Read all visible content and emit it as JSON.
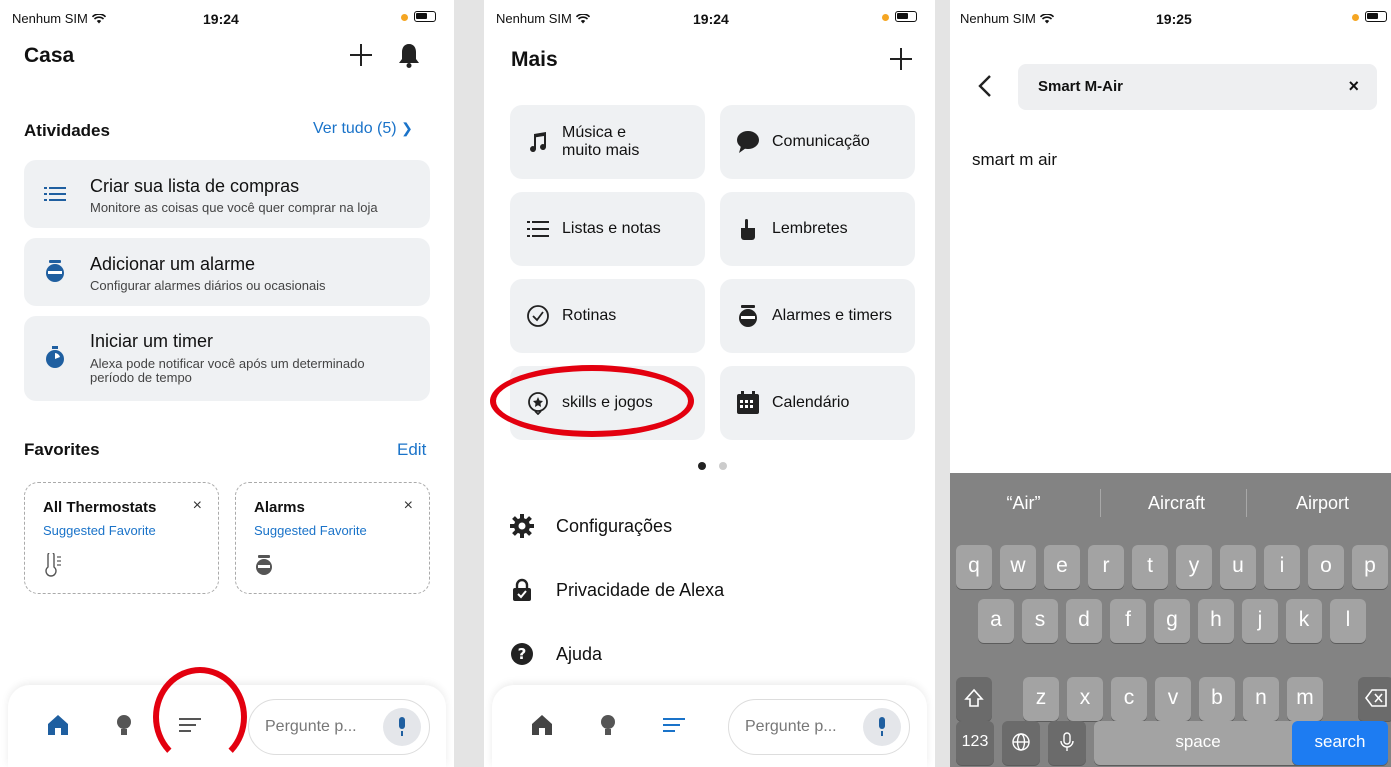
{
  "status_bar": {
    "carrier": "Nenhum SIM",
    "times": [
      "19:24",
      "19:24",
      "19:25"
    ]
  },
  "screen1": {
    "title": "Casa",
    "activities_title": "Atividades",
    "see_all": "Ver tudo (5)",
    "cards": [
      {
        "title": "Criar sua lista de compras",
        "subtitle": "Monitore as coisas que você quer comprar na loja",
        "icon": "list-icon"
      },
      {
        "title": "Adicionar um alarme",
        "subtitle": "Configurar alarmes diários ou ocasionais",
        "icon": "alarm-clock-icon"
      },
      {
        "title": "Iniciar um timer",
        "subtitle": "Alexa pode notificar você após um determinado período de tempo",
        "icon": "timer-icon"
      }
    ],
    "favorites_title": "Favorites",
    "edit": "Edit",
    "favorites": [
      {
        "title": "All Thermostats",
        "subtitle": "Suggested Favorite",
        "close": "×",
        "icon": "thermostat-icon"
      },
      {
        "title": "Alarms",
        "subtitle": "Suggested Favorite",
        "close": "×",
        "icon": "alarm-clock-icon"
      }
    ],
    "ask_placeholder": "Pergunte p..."
  },
  "screen2": {
    "title": "Mais",
    "tiles": [
      {
        "label": "Música e\nmuito mais",
        "icon": "music-note-icon"
      },
      {
        "label": "Comunicação",
        "icon": "chat-bubble-icon"
      },
      {
        "label": "Listas e notas",
        "icon": "list-icon"
      },
      {
        "label": "Lembretes",
        "icon": "reminder-hand-icon"
      },
      {
        "label": "Rotinas",
        "icon": "routine-check-icon"
      },
      {
        "label": "Alarmes e timers",
        "icon": "alarm-clock-icon"
      },
      {
        "label": "skills e jogos",
        "icon": "skills-badge-icon"
      },
      {
        "label": "Calendário",
        "icon": "calendar-icon"
      }
    ],
    "menu": [
      {
        "label": "Configurações",
        "icon": "gear-icon"
      },
      {
        "label": "Privacidade de Alexa",
        "icon": "lock-icon"
      },
      {
        "label": "Ajuda",
        "icon": "help-icon"
      }
    ],
    "ask_placeholder": "Pergunte p..."
  },
  "screen3": {
    "search_value": "Smart M-Air",
    "clear": "×",
    "result": "smart m air",
    "suggestions": [
      "“Air”",
      "Aircraft",
      "Airport"
    ],
    "keyboard": {
      "row1": [
        "q",
        "w",
        "e",
        "r",
        "t",
        "y",
        "u",
        "i",
        "o",
        "p"
      ],
      "row2": [
        "a",
        "s",
        "d",
        "f",
        "g",
        "h",
        "j",
        "k",
        "l"
      ],
      "row3": [
        "z",
        "x",
        "c",
        "v",
        "b",
        "n",
        "m"
      ],
      "numbers": "123",
      "space": "space",
      "search": "search"
    }
  },
  "colors": {
    "accent": "#1a73c9",
    "annotation": "#e3000f",
    "keyboard_bg": "#838383",
    "search_key": "#1d7cf2"
  }
}
